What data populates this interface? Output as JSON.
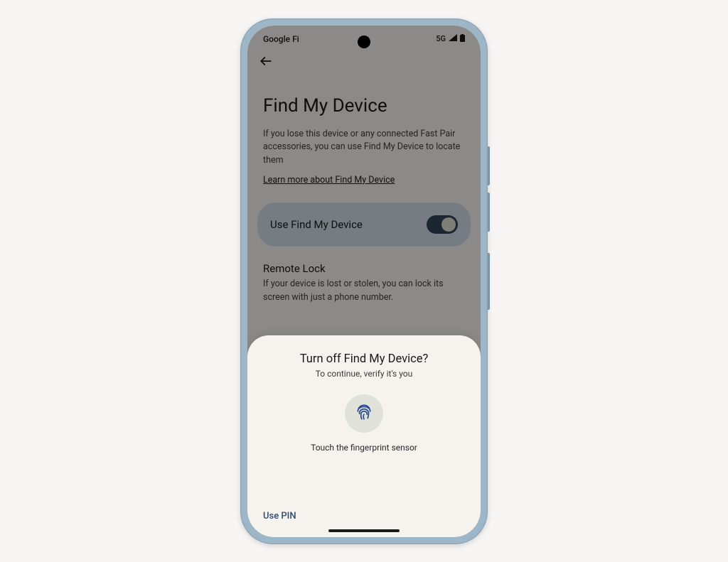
{
  "status": {
    "carrier": "Google Fi",
    "network": "5G"
  },
  "page": {
    "title": "Find My Device",
    "description": "If you lose this device or any connected Fast Pair accessories, you can use Find My Device to locate them",
    "learn_link": "Learn more about Find My Device"
  },
  "toggle": {
    "label": "Use Find My Device",
    "on": true
  },
  "remote_lock": {
    "header": "Remote Lock",
    "description": "If your device is lost or stolen, you can lock its screen with just a phone number."
  },
  "sheet": {
    "title": "Turn off Find My Device?",
    "subtitle": "To continue, verify it's you",
    "hint": "Touch the fingerprint sensor",
    "use_pin": "Use PIN"
  }
}
